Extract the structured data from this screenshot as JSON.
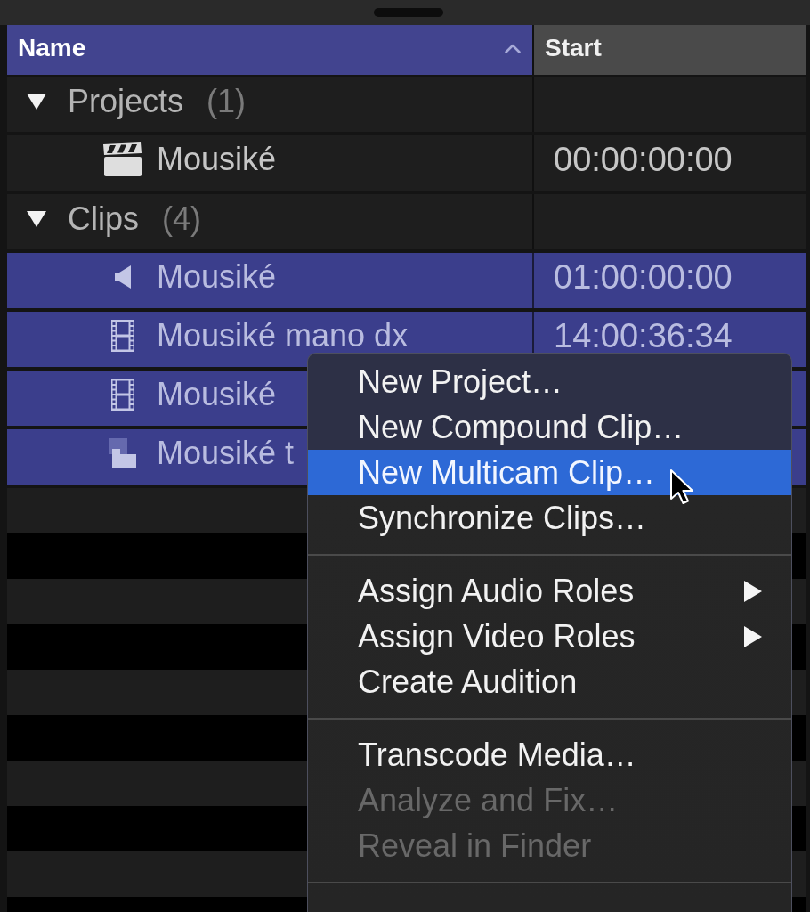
{
  "columns": [
    {
      "label": "Name",
      "sorted": true
    },
    {
      "label": "Start",
      "sorted": false
    }
  ],
  "tree": [
    {
      "label": "Projects",
      "count": "(1)",
      "expanded": true,
      "children": [
        {
          "kind": "project",
          "name": "Mousiké",
          "start": "00:00:00:00",
          "selected": false
        }
      ]
    },
    {
      "label": "Clips",
      "count": "(4)",
      "expanded": true,
      "children": [
        {
          "kind": "audio",
          "name": "Mousiké",
          "start": "01:00:00:00",
          "selected": true
        },
        {
          "kind": "video",
          "name": "Mousiké mano dx",
          "start": "14:00:36:34",
          "selected": true
        },
        {
          "kind": "video",
          "name": "Mousiké",
          "selected": true
        },
        {
          "kind": "compound",
          "name": "Mousiké t",
          "selected": true
        }
      ]
    }
  ],
  "context_menu": {
    "items": [
      {
        "kind": "item",
        "label": "New Project…",
        "selected": false,
        "disabled": false,
        "submenu": false
      },
      {
        "kind": "item",
        "label": "New Compound Clip…",
        "selected": false,
        "disabled": false,
        "submenu": false
      },
      {
        "kind": "item",
        "label": "New Multicam Clip…",
        "selected": true,
        "disabled": false,
        "submenu": false
      },
      {
        "kind": "item",
        "label": "Synchronize Clips…",
        "selected": false,
        "disabled": false,
        "submenu": false
      },
      {
        "kind": "separator"
      },
      {
        "kind": "item",
        "label": "Assign Audio Roles",
        "selected": false,
        "disabled": false,
        "submenu": true
      },
      {
        "kind": "item",
        "label": "Assign Video Roles",
        "selected": false,
        "disabled": false,
        "submenu": true
      },
      {
        "kind": "item",
        "label": "Create Audition",
        "selected": false,
        "disabled": false,
        "submenu": false
      },
      {
        "kind": "separator"
      },
      {
        "kind": "item",
        "label": "Transcode Media…",
        "selected": false,
        "disabled": false,
        "submenu": false
      },
      {
        "kind": "item",
        "label": "Analyze and Fix…",
        "selected": false,
        "disabled": true,
        "submenu": false
      },
      {
        "kind": "item",
        "label": "Reveal in Finder",
        "selected": false,
        "disabled": true,
        "submenu": false
      },
      {
        "kind": "separator"
      }
    ]
  }
}
